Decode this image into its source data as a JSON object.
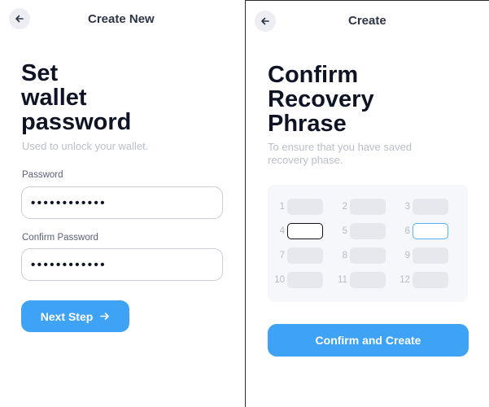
{
  "left": {
    "header_title": "Create New",
    "title_lines": [
      "Set",
      "wallet",
      "password"
    ],
    "subtitle": "Used to unlock your wallet.",
    "password_label": "Password",
    "password_value": "••••••••••••",
    "confirm_label": "Confirm Password",
    "confirm_value": "••••••••••••",
    "next_button": "Next Step"
  },
  "right": {
    "header_title": "Create",
    "title_lines": [
      "Confirm",
      "Recovery",
      "Phrase"
    ],
    "subtitle": "To ensure that you have saved recovery phase.",
    "slots": [
      {
        "n": "1",
        "state": "empty"
      },
      {
        "n": "2",
        "state": "empty"
      },
      {
        "n": "3",
        "state": "empty"
      },
      {
        "n": "4",
        "state": "selected"
      },
      {
        "n": "5",
        "state": "empty"
      },
      {
        "n": "6",
        "state": "focused"
      },
      {
        "n": "7",
        "state": "empty"
      },
      {
        "n": "8",
        "state": "empty"
      },
      {
        "n": "9",
        "state": "empty"
      },
      {
        "n": "10",
        "state": "empty"
      },
      {
        "n": "11",
        "state": "empty"
      },
      {
        "n": "12",
        "state": "empty"
      }
    ],
    "confirm_button": "Confirm and Create"
  },
  "colors": {
    "accent": "#3ea2f5",
    "title": "#0f1425",
    "muted": "#b9bec9",
    "slot": "#e6e8ed"
  },
  "icons": {
    "back": "arrow-left-icon",
    "next": "arrow-right-icon"
  }
}
